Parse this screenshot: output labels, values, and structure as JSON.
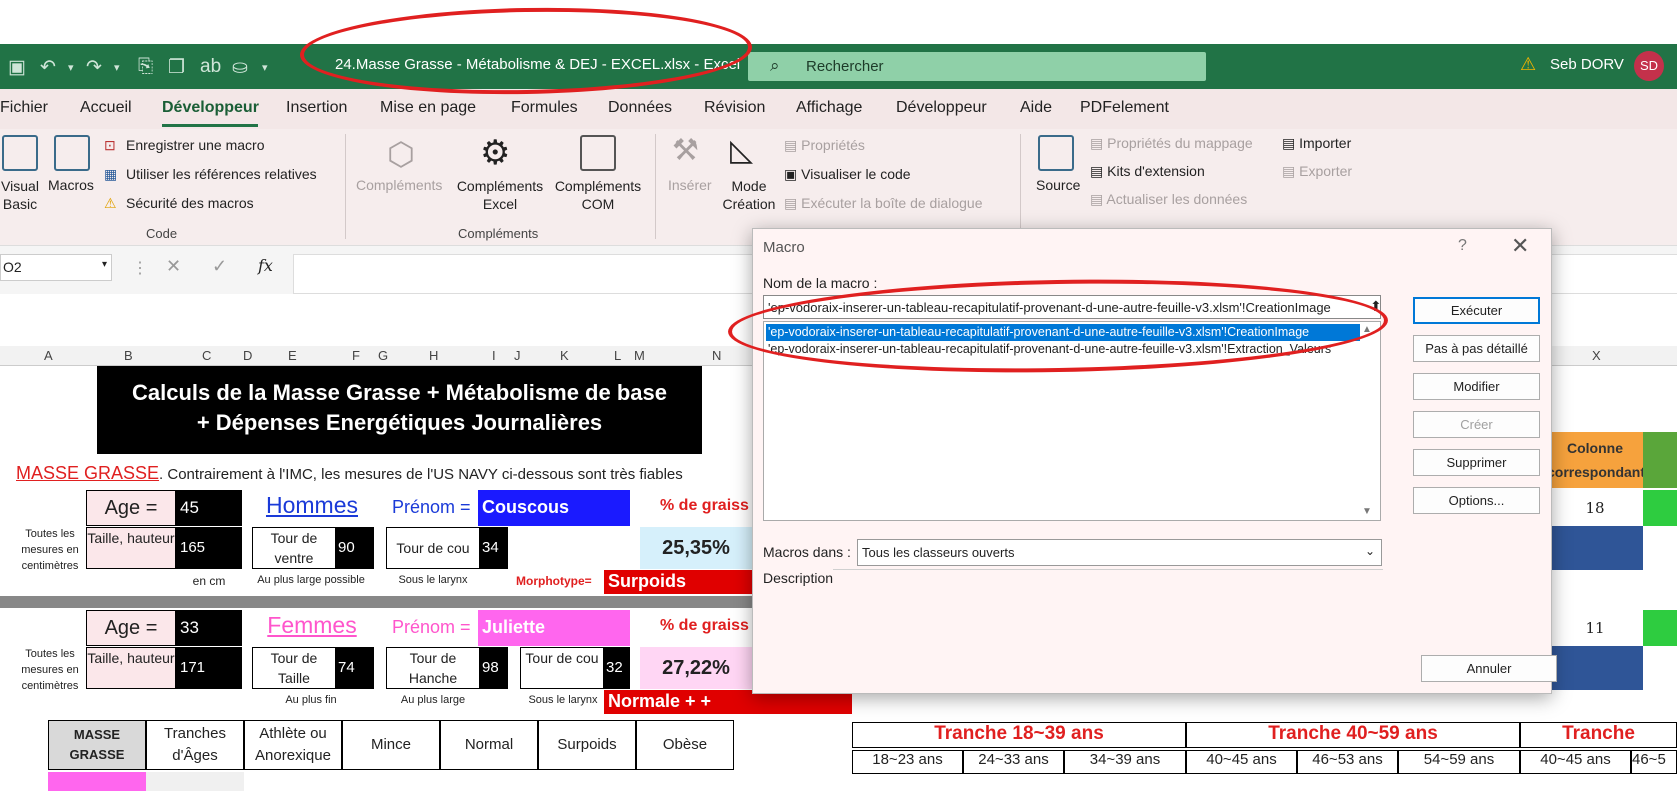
{
  "titlebar": {
    "document_title": "24.Masse Grasse - Métabolisme & DEJ - EXCEL.xlsx  -  Excel",
    "search_placeholder": "Rechercher",
    "user_name": "Seb DORV",
    "user_initials": "SD"
  },
  "menu": [
    "Fichier",
    "Accueil",
    "Développeur",
    "Insertion",
    "Mise en page",
    "Formules",
    "Données",
    "Révision",
    "Affichage",
    "Développeur",
    "Aide",
    "PDFelement"
  ],
  "menu_active_index": 2,
  "ribbon": {
    "visual_basic": "Visual Basic",
    "macros": "Macros",
    "record_macro": "Enregistrer une macro",
    "relative_refs": "Utiliser les références relatives",
    "macro_security": "Sécurité des macros",
    "group_code": "Code",
    "addins": "Compléments",
    "excel_addins": "Compléments Excel",
    "com_addins": "Compléments COM",
    "group_addins": "Compléments",
    "insert": "Insérer",
    "design_mode": "Mode Création",
    "properties": "Propriétés",
    "view_code": "Visualiser le code",
    "run_dialog": "Exécuter la boîte de dialogue",
    "source": "Source",
    "map_properties": "Propriétés du mappage",
    "expansion_packs": "Kits d'extension",
    "refresh_data": "Actualiser les données",
    "import": "Importer",
    "export": "Exporter"
  },
  "formula_bar": {
    "name_box": "O2",
    "fx": "fx"
  },
  "columns": [
    "A",
    "B",
    "C",
    "D",
    "E",
    "F",
    "G",
    "H",
    "I",
    "J",
    "K",
    "L",
    "M",
    "N",
    "X"
  ],
  "sheet": {
    "title_line1": "Calculs de la Masse Grasse + Métabolisme de base",
    "title_line2": "+ Dépenses Energétiques Journalières",
    "masse_grasse": "MASSE GRASSE",
    "intro": ". Contrairement à l'IMC, les mesures de l'US NAVY ci-dessous sont très fiables",
    "all_measures": "Toutes les mesures en centimètres",
    "age_label": "Age =",
    "men": {
      "age": "45",
      "header": "Hommes",
      "prenom_label": "Prénom =",
      "prenom": "Couscous",
      "height": "165",
      "tour_ventre_label": "Tour de ventre",
      "tour_ventre": "90",
      "tour_cou_label": "Tour de cou",
      "tour_cou": "34",
      "pct_label": "% de graiss",
      "pct": "25,35%",
      "morph_label": "Morphotype=",
      "morph": "Surpoids"
    },
    "women": {
      "age": "33",
      "header": "Femmes",
      "prenom_label": "Prénom =",
      "prenom": "Juliette",
      "height": "171",
      "tour_taille_label": "Tour de Taille",
      "tour_taille": "74",
      "tour_hanche_label": "Tour de Hanche",
      "tour_hanche": "98",
      "tour_cou_label": "Tour de cou",
      "tour_cou": "32",
      "pct_label": "% de graiss",
      "pct": "27,22%",
      "morph": "Normale  +  +"
    },
    "taille_label": "Taille, hauteur",
    "en_cm": "en cm",
    "au_plus_large_possible": "Au plus large possible",
    "sous_larynx": "Sous le larynx",
    "au_plus_fin": "Au plus fin",
    "au_plus_large": "Au plus large",
    "colonne_corresp": "Colonne correspondante",
    "x_values": [
      "18",
      "11"
    ],
    "table_headers": [
      "MASSE GRASSE",
      "Tranches d'Âges",
      "Athlète ou Anorexique",
      "Mince",
      "Normal",
      "Surpoids",
      "Obèse"
    ],
    "tranche_18_39": "Tranche 18~39 ans",
    "tranche_40_59": "Tranche 40~59 ans",
    "tranche_cut": "Tranche",
    "age_ranges": [
      "18~23 ans",
      "24~33 ans",
      "34~39 ans",
      "40~45 ans",
      "46~53 ans",
      "54~59 ans",
      "40~45 ans",
      "46~5"
    ]
  },
  "dialog": {
    "title": "Macro",
    "help": "?",
    "close": "✕",
    "name_label": "Nom de la macro :",
    "name_value": "'ep-vodoraix-inserer-un-tableau-recapitulatif-provenant-d-une-autre-feuille-v3.xlsm'!CreationImage",
    "macros": [
      "'ep-vodoraix-inserer-un-tableau-recapitulatif-provenant-d-une-autre-feuille-v3.xlsm'!CreationImage",
      "'ep-vodoraix-inserer-un-tableau-recapitulatif-provenant-d-une-autre-feuille-v3.xlsm'!Extraction_Valeurs"
    ],
    "buttons": {
      "run": "Exécuter",
      "step": "Pas à pas détaillé",
      "edit": "Modifier",
      "create": "Créer",
      "delete": "Supprimer",
      "options": "Options...",
      "cancel": "Annuler"
    },
    "macros_in_label": "Macros dans :",
    "macros_in_value": "Tous les classeurs ouverts",
    "description_label": "Description"
  },
  "colors": {
    "excel_green": "#217346",
    "annotation_red": "#e02020",
    "selection_blue": "#0078d7"
  }
}
